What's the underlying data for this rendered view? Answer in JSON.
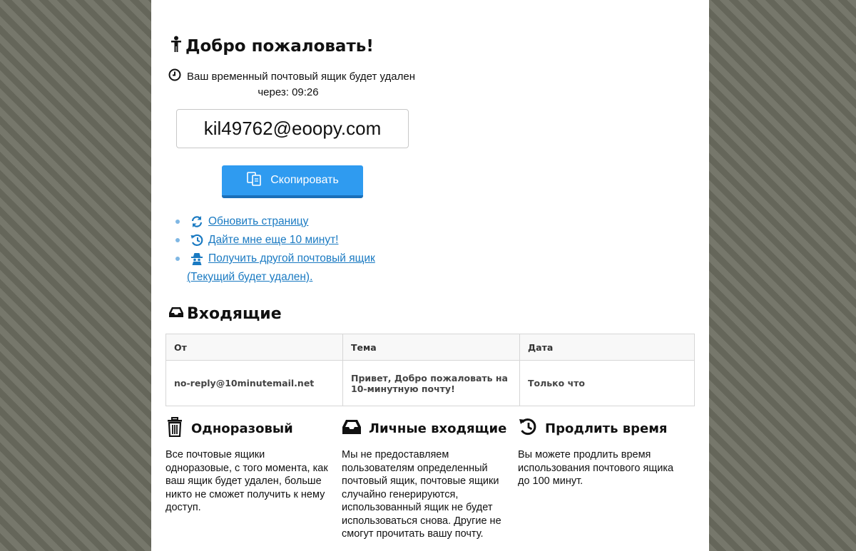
{
  "welcome": {
    "title": "Добро пожаловать!"
  },
  "timer": {
    "line1": "Ваш временный почтовый ящик будет удален",
    "line2": "через: 09:26"
  },
  "email": {
    "address": "kil49762@eoopy.com"
  },
  "copy_button": {
    "label": "Скопировать"
  },
  "links": [
    {
      "label": " Обновить страницу",
      "icon": "refresh-icon"
    },
    {
      "label": " Дайте мне еще 10 минут!",
      "icon": "history-icon"
    },
    {
      "label": " Получить другой почтовый ящик",
      "continuation": "(Текущий будет удален).",
      "icon": "spy-icon"
    }
  ],
  "inbox": {
    "title": "Входящие",
    "columns": [
      "От",
      "Тема",
      "Дата"
    ],
    "rows": [
      {
        "from": "no-reply@10minutemail.net",
        "subject": "Привет, Добро пожаловать на 10-минутную почту!",
        "date": "Только что"
      }
    ]
  },
  "features": [
    {
      "title": "Одноразовый",
      "icon": "trash-icon",
      "text": "Все почтовые ящики одноразовые, с того момента, как ваш ящик будет удален, больше никто не сможет получить к нему доступ."
    },
    {
      "title": "Личные входящие",
      "icon": "inbox-icon",
      "text": "Мы не предоставляем пользователям определенный почтовый ящик, почтовые ящики случайно генерируются, использованный ящик не будет использоваться снова. Другие не смогут прочитать вашу почту."
    },
    {
      "title": "Продлить время",
      "icon": "history-icon",
      "text": "Вы можете продлить время использования почтового ящика до 100 минут."
    }
  ],
  "colors": {
    "accent": "#2f9bf0",
    "link": "#1a7ac2",
    "background": "#6e6f63"
  }
}
